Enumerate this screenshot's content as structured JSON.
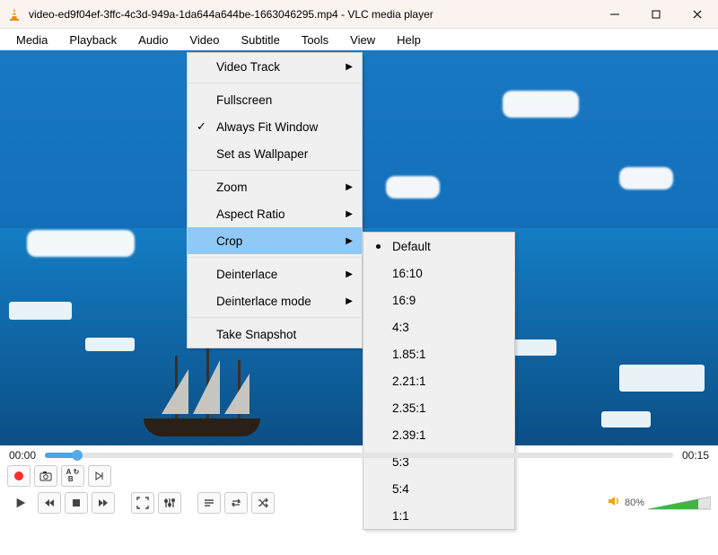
{
  "title": "video-ed9f04ef-3ffc-4c3d-949a-1da644a644be-1663046295.mp4 - VLC media player",
  "menubar": [
    "Media",
    "Playback",
    "Audio",
    "Video",
    "Subtitle",
    "Tools",
    "View",
    "Help"
  ],
  "video_menu": {
    "video_track": "Video Track",
    "fullscreen": "Fullscreen",
    "always_fit": "Always Fit Window",
    "set_wallpaper": "Set as Wallpaper",
    "zoom": "Zoom",
    "aspect": "Aspect Ratio",
    "crop": "Crop",
    "deinterlace": "Deinterlace",
    "deinterlace_mode": "Deinterlace mode",
    "snapshot": "Take Snapshot"
  },
  "crop_menu": [
    "Default",
    "16:10",
    "16:9",
    "4:3",
    "1.85:1",
    "2.21:1",
    "2.35:1",
    "2.39:1",
    "5:3",
    "5:4",
    "1:1"
  ],
  "time": {
    "current": "00:00",
    "total": "00:15"
  },
  "volume": {
    "percent": "80%"
  }
}
